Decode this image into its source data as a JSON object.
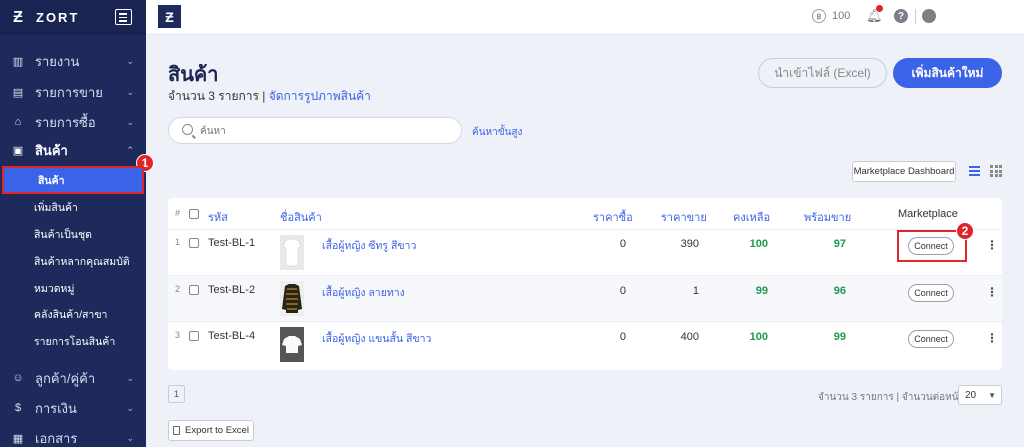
{
  "sidebar": {
    "brand": "ZORT",
    "items": [
      {
        "label": "รายงาน",
        "icon": "chart-icon"
      },
      {
        "label": "รายการขาย",
        "icon": "clipboard-icon"
      },
      {
        "label": "รายการซื้อ",
        "icon": "basket-icon"
      },
      {
        "label": "สินค้า",
        "icon": "box-icon"
      },
      {
        "label": "ลูกค้า/คู่ค้า",
        "icon": "users-icon"
      },
      {
        "label": "การเงิน",
        "icon": "dollar-icon"
      },
      {
        "label": "เอกสาร",
        "icon": "document-icon"
      }
    ],
    "sub_items": [
      {
        "label": "สินค้า"
      },
      {
        "label": "เพิ่มสินค้า"
      },
      {
        "label": "สินค้าเป็นชุด"
      },
      {
        "label": "สินค้าหลากคุณสมบัติ"
      },
      {
        "label": "หมวดหมู่"
      },
      {
        "label": "คลังสินค้า/สาขา"
      },
      {
        "label": "รายการโอนสินค้า"
      }
    ]
  },
  "topbar": {
    "coins": "100",
    "accent": "#3a63e8"
  },
  "page": {
    "title": "สินค้า",
    "count_text": "จำนวน 3 รายการ | ",
    "manage_images_link": "จัดการรูปภาพสินค้า",
    "import_button": "นำเข้าไฟล์ (Excel)",
    "add_button": "เพิ่มสินค้าใหม่",
    "search_placeholder": "ค้นหา",
    "advanced_search": "ค้นหาขั้นสูง",
    "marketplace_dashboard": "Marketplace Dashboard"
  },
  "table": {
    "headers": {
      "hash": "#",
      "code": "รหัส",
      "name": "ชื่อสินค้า",
      "purchase_price": "ราคาซื้อ",
      "sale_price": "ราคาขาย",
      "remaining": "คงเหลือ",
      "available": "พร้อมขาย",
      "marketplace": "Marketplace"
    },
    "rows": [
      {
        "num": "1",
        "code": "Test-BL-1",
        "name": "เสื้อผู้หญิง ซีทรู สีขาว",
        "purchase": "0",
        "sale": "390",
        "remaining": "100",
        "available": "97",
        "action": "Connect"
      },
      {
        "num": "2",
        "code": "Test-BL-2",
        "name": "เสื้อผู้หญิง ลายทาง",
        "purchase": "0",
        "sale": "1",
        "remaining": "99",
        "available": "96",
        "action": "Connect"
      },
      {
        "num": "3",
        "code": "Test-BL-4",
        "name": "เสื้อผู้หญิง แขนสั้น สีขาว",
        "purchase": "0",
        "sale": "400",
        "remaining": "100",
        "available": "99",
        "action": "Connect"
      }
    ]
  },
  "footer": {
    "page": "1",
    "info": "จำนวน 3 รายการ | จำนวนต่อหน้า",
    "per_page": "20",
    "export": "Export to Excel"
  },
  "annotations": {
    "step1": "1",
    "step2": "2",
    "highlight_color": "#e0242a"
  }
}
